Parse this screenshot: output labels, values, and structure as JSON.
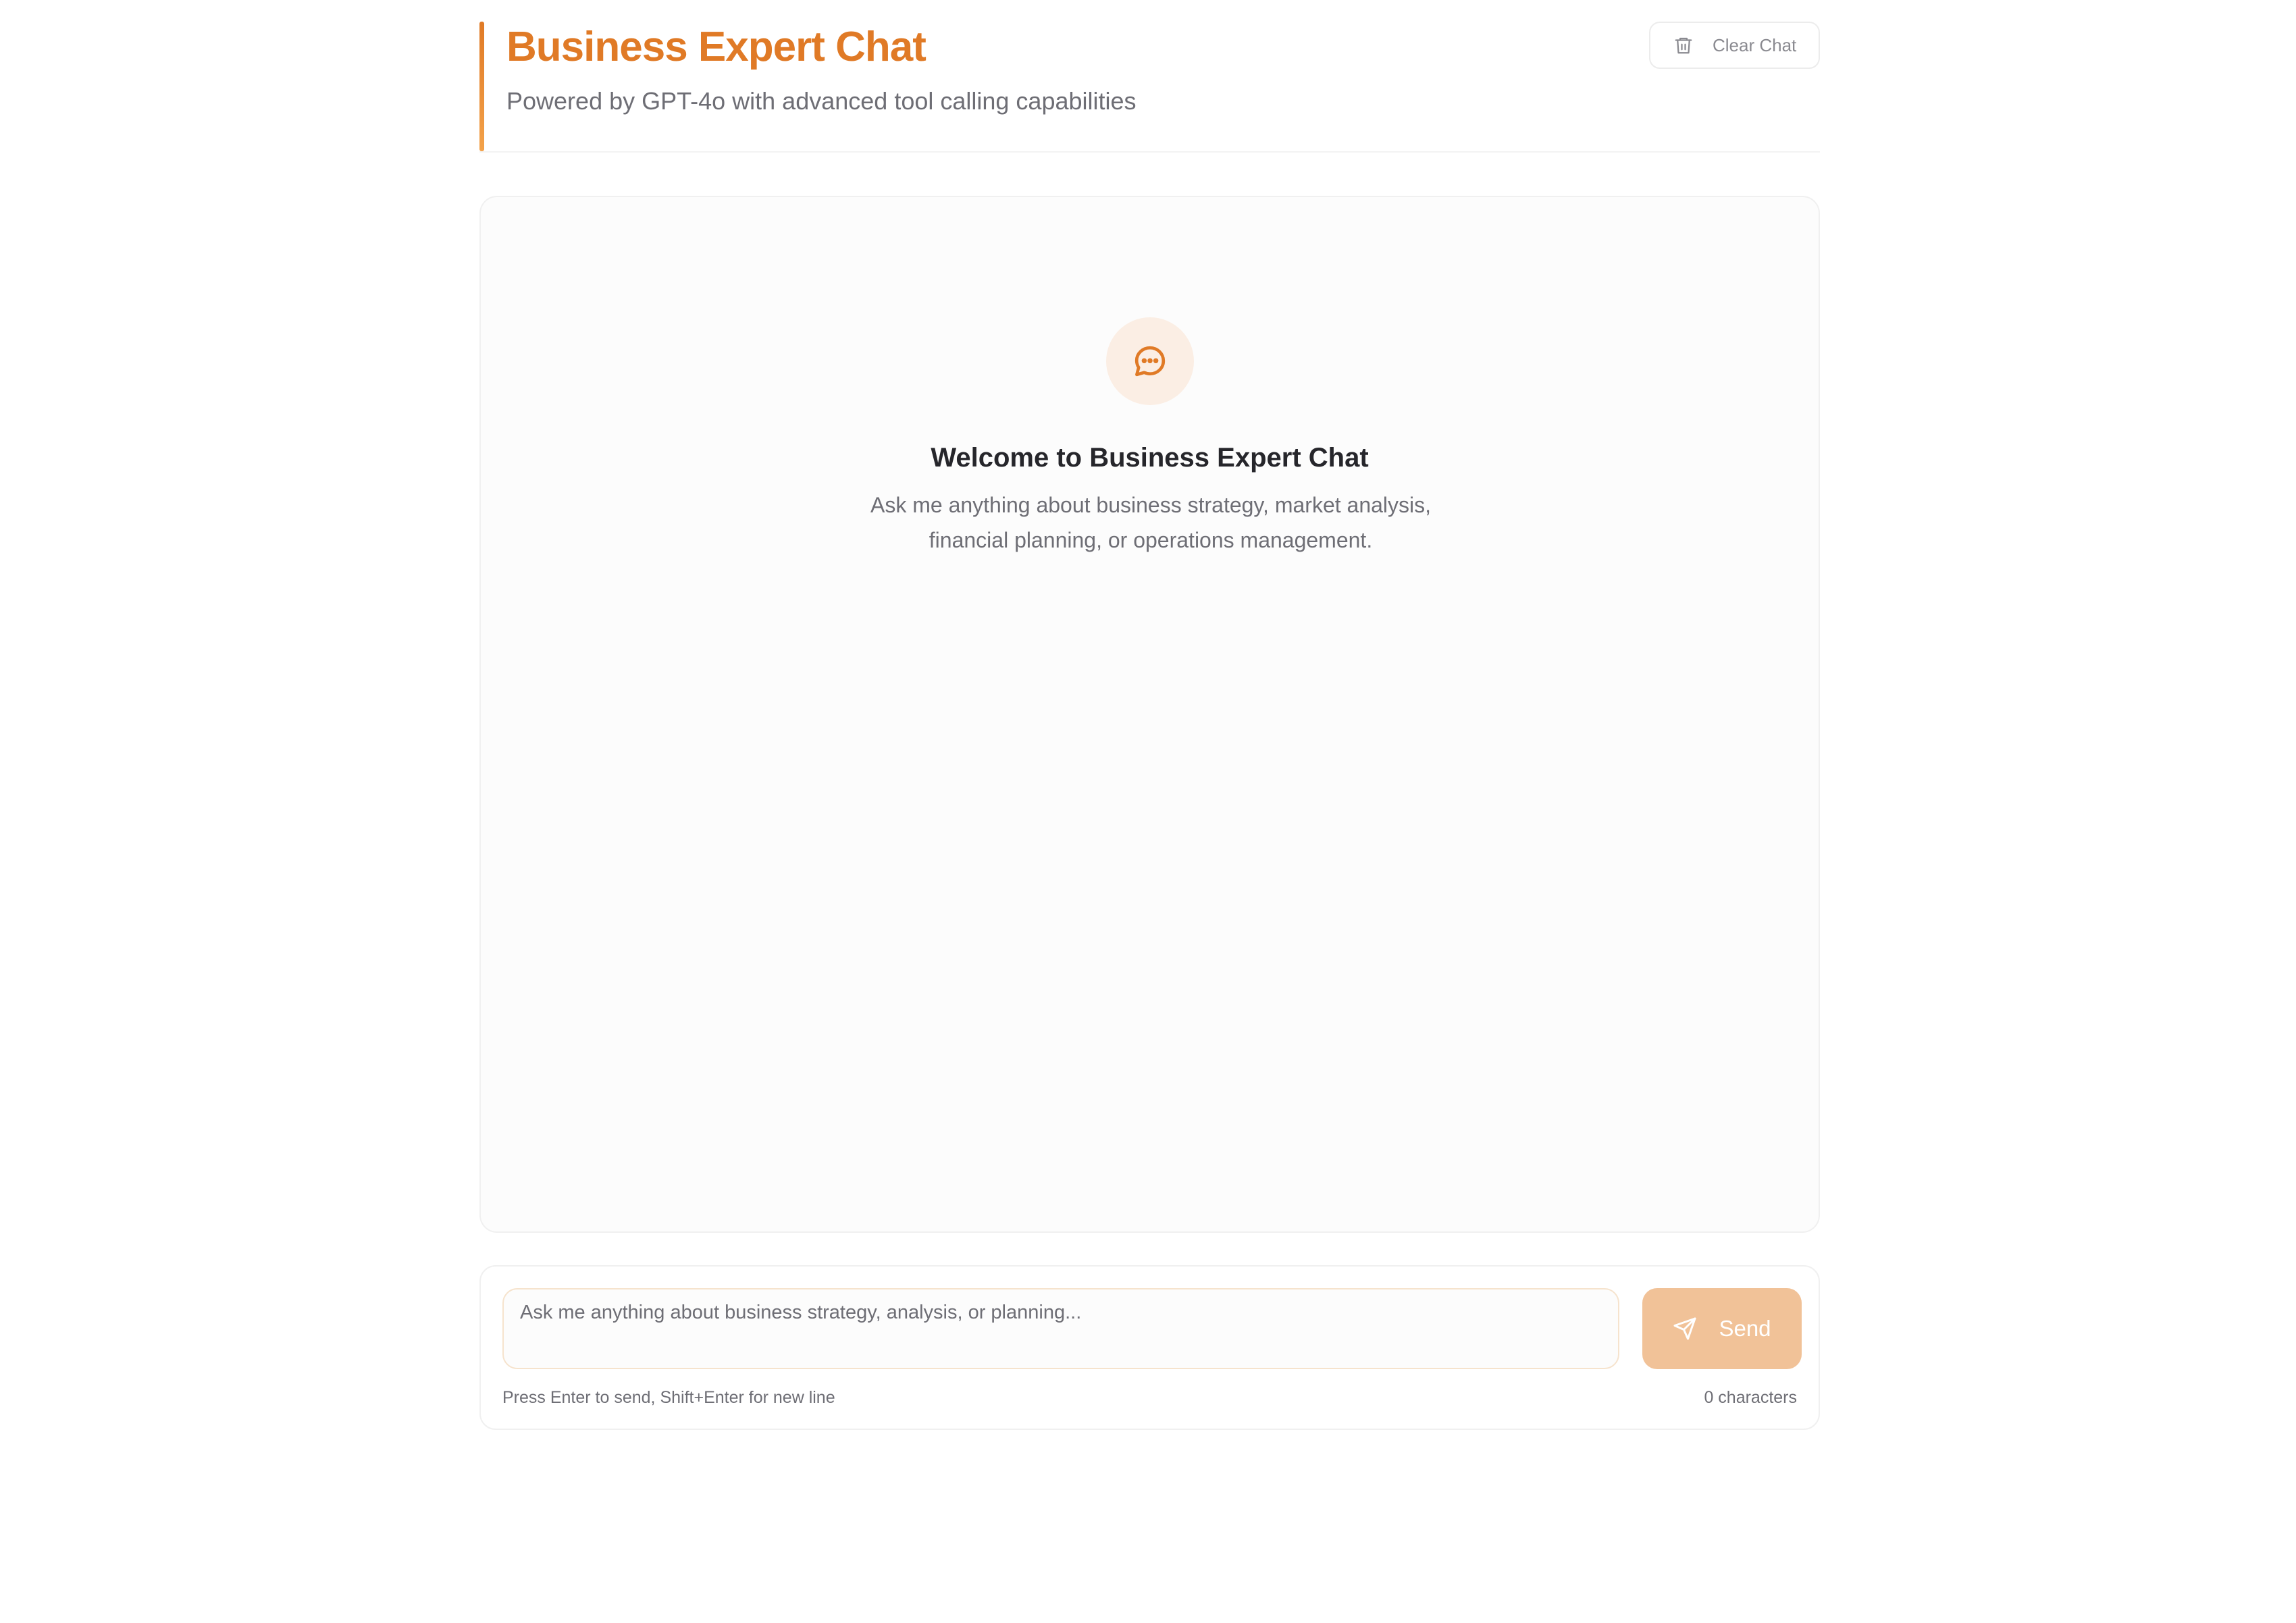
{
  "header": {
    "title": "Business Expert Chat",
    "subtitle": "Powered by GPT-4o with advanced tool calling capabilities",
    "clear_button_label": "Clear Chat",
    "clear_icon": "trash-icon"
  },
  "welcome": {
    "icon": "chat-bubble-icon",
    "title": "Welcome to Business Expert Chat",
    "text": "Ask me anything about business strategy, market analysis, financial planning, or operations management."
  },
  "composer": {
    "input_value": "",
    "input_placeholder": "Ask me anything about business strategy, analysis, or planning...",
    "send_label": "Send",
    "send_icon": "send-icon",
    "hint": "Press Enter to send, Shift+Enter for new line",
    "char_count": "0 characters"
  },
  "colors": {
    "accent": "#e07a26",
    "send_button_disabled": "#f1c298",
    "welcome_icon_bg": "#fbeee4"
  }
}
